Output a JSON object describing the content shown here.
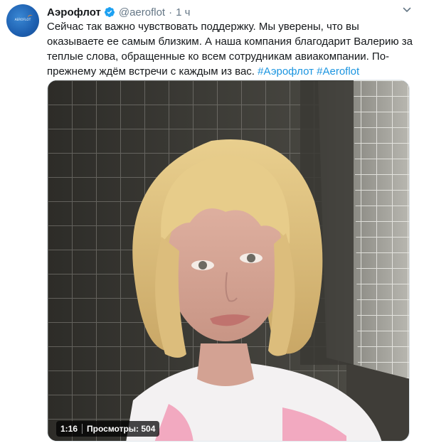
{
  "tweet": {
    "author_name": "Аэрофлот",
    "handle": "@aeroflot",
    "separator": "·",
    "time": "1 ч",
    "text_lines": [
      "Сейчас так важно чувствовать поддержку. Мы уверены, что вы",
      "оказываете ее самым близким. А наша компания благодарит Валерию за",
      "теплые слова, обращенные ко всем сотрудникам авиакомпании. По-"
    ],
    "last_line_text": "прежнему ждём встречи с каждым из вас. ",
    "hashtags": [
      "#Аэрофлот",
      "#Aeroflot"
    ],
    "avatar_text": "AEROFLOT",
    "icons": {
      "verified": "verified-badge-icon",
      "menu": "chevron-down-icon"
    }
  },
  "video": {
    "duration": "1:16",
    "views_label": "Просмотры: 504"
  },
  "colors": {
    "link": "#1b95e0",
    "secondary_text": "#657786",
    "verified": "#1da1f2",
    "avatar": "#1d5fb0"
  }
}
